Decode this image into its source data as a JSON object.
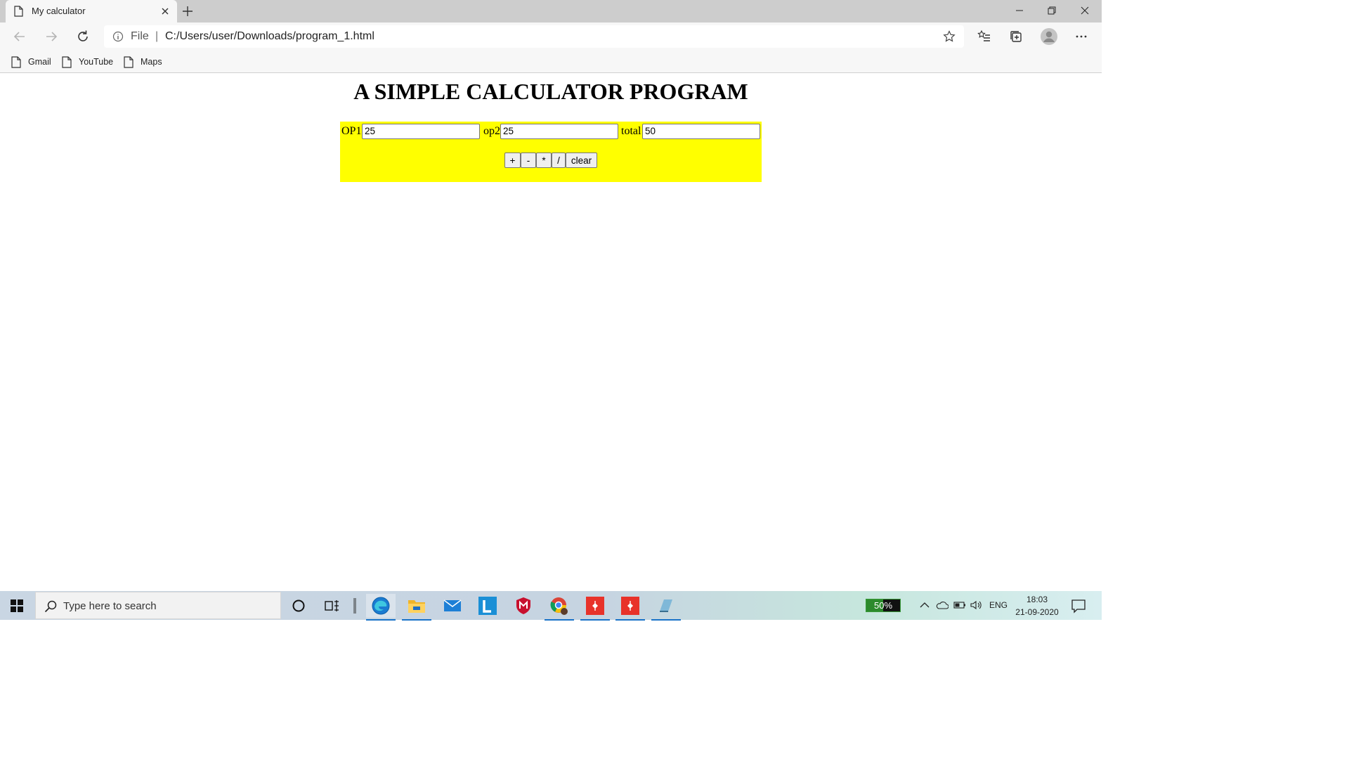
{
  "browser": {
    "tab_title": "My calculator",
    "address_scheme": "File",
    "address_separator": "|",
    "address_url": "C:/Users/user/Downloads/program_1.html",
    "bookmarks": [
      {
        "label": "Gmail"
      },
      {
        "label": "YouTube"
      },
      {
        "label": "Maps"
      }
    ]
  },
  "page": {
    "title": "A SIMPLE CALCULATOR PROGRAM",
    "fields": [
      {
        "label": "OP1",
        "value": "25"
      },
      {
        "label": "op2",
        "value": "25"
      },
      {
        "label": "total",
        "value": "50"
      }
    ],
    "buttons": [
      {
        "label": "+"
      },
      {
        "label": "-"
      },
      {
        "label": "*"
      },
      {
        "label": "/"
      },
      {
        "label": "clear"
      }
    ],
    "panel_color": "#ffff00"
  },
  "taskbar": {
    "search_placeholder": "Type here to search",
    "battery_percent": 50,
    "battery_label": "50%",
    "language": "ENG",
    "time": "18:03",
    "date": "21-09-2020",
    "apps": [
      "cortana-icon",
      "task-view-icon",
      "edge-icon",
      "file-explorer-icon",
      "mail-icon",
      "l-app-icon",
      "mcafee-icon",
      "chrome-icon",
      "git-icon-1",
      "git-icon-2",
      "notes-app-icon"
    ]
  }
}
